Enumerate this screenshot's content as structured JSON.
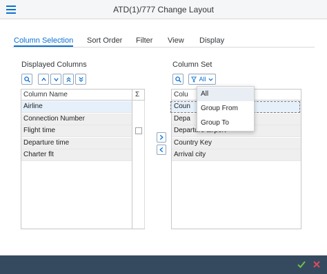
{
  "window": {
    "title": "ATD(1)/777 Change Layout"
  },
  "tabs": [
    {
      "label": "Column Selection"
    },
    {
      "label": "Sort Order"
    },
    {
      "label": "Filter"
    },
    {
      "label": "View"
    },
    {
      "label": "Display"
    }
  ],
  "displayed": {
    "title": "Displayed Columns",
    "header": {
      "name": "Column Name",
      "sigma": "Σ"
    },
    "rows": [
      {
        "label": "Airline"
      },
      {
        "label": "Connection Number"
      },
      {
        "label": "Flight time"
      },
      {
        "label": "Departure time"
      },
      {
        "label": "Charter flt"
      }
    ]
  },
  "column_set": {
    "title": "Column Set",
    "filter_label": "All",
    "header": {
      "name": "Colu"
    },
    "rows": [
      {
        "label": "Coun"
      },
      {
        "label": "Depa"
      },
      {
        "label": "Departure airport"
      },
      {
        "label": "Country Key"
      },
      {
        "label": "Arrival city"
      }
    ]
  },
  "filter_menu": {
    "items": [
      {
        "label": "All"
      },
      {
        "label": "Group From"
      },
      {
        "label": "Group To"
      }
    ]
  },
  "colors": {
    "accent": "#0a6ed1",
    "footer": "#354a5f",
    "ok": "#6fc04b",
    "cancel": "#e04b5a"
  }
}
